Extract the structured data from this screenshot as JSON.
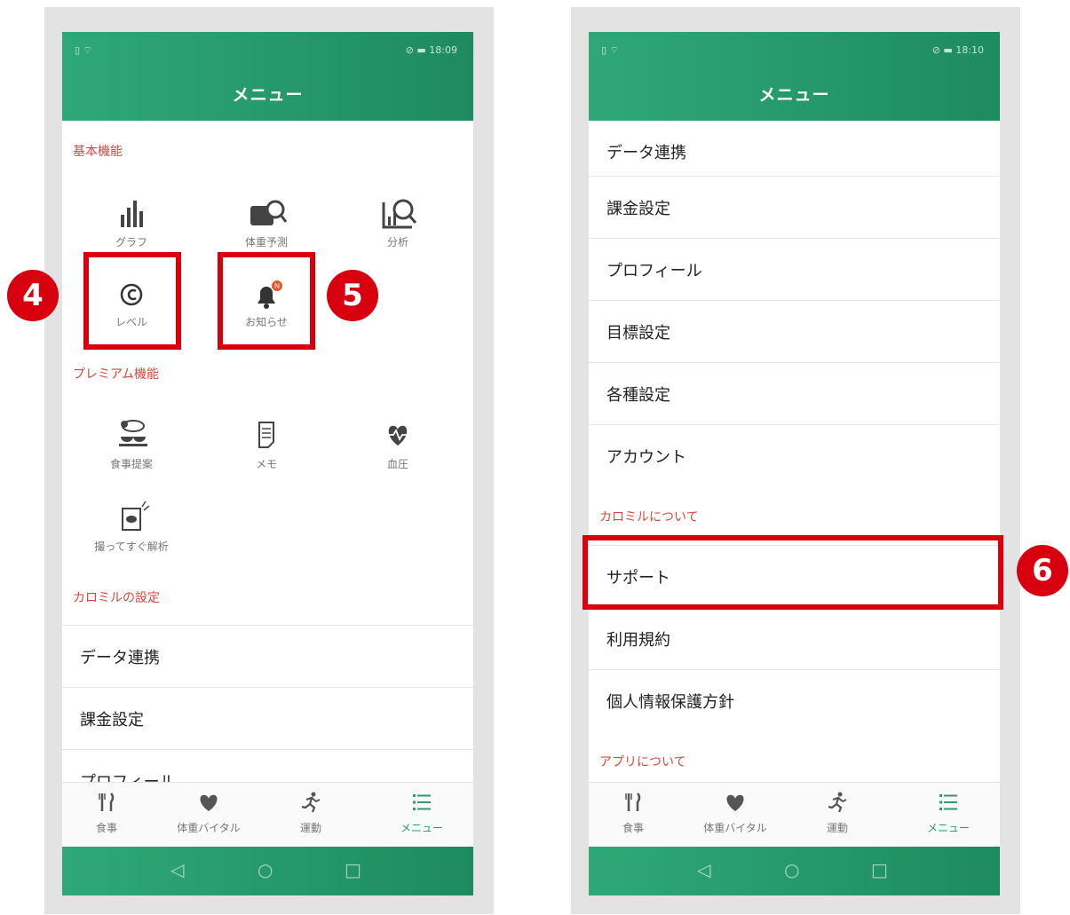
{
  "left": {
    "status_left": "▯ ⌔",
    "status_right": "⊘ ▬ 18:09",
    "header_title": "メニュー",
    "section_basic": "基本機能",
    "grid_basic": [
      "グラフ",
      "体重予測",
      "分析",
      "レベル",
      "お知らせ"
    ],
    "notification_badge": "N",
    "section_premium": "プレミアム機能",
    "grid_premium": [
      "食事提案",
      "メモ",
      "血圧",
      "撮ってすぐ解析"
    ],
    "section_settings": "カロミルの設定",
    "rows": [
      "データ連携",
      "課金設定",
      "プロフィール"
    ]
  },
  "right": {
    "status_left": "▯ ⌔",
    "status_right": "⊘ ▬ 18:10",
    "header_title": "メニュー",
    "rows_settings": [
      "データ連携",
      "課金設定",
      "プロフィール",
      "目標設定",
      "各種設定",
      "アカウント"
    ],
    "section_about": "カロミルについて",
    "rows_about": [
      "サポート",
      "利用規約",
      "個人情報保護方針"
    ],
    "section_app": "アプリについて"
  },
  "bottom_tabs": [
    "食事",
    "体重バイタル",
    "運動",
    "メニュー"
  ],
  "system_nav": [
    "◁",
    "○",
    "□"
  ],
  "callouts": [
    "4",
    "5",
    "6"
  ],
  "colors": {
    "accent_green": "#2e9b6c",
    "section_red": "#d9463b",
    "highlight_red": "#d8000f"
  }
}
